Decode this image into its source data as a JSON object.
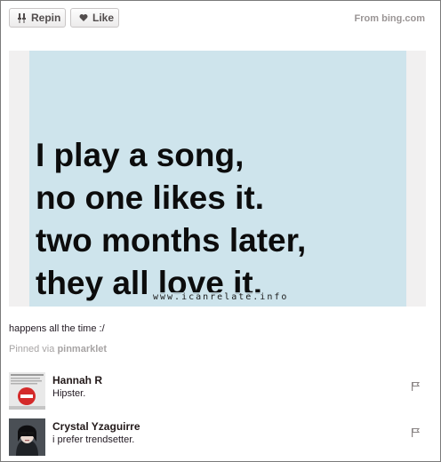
{
  "actions": {
    "repin_label": "Repin",
    "like_label": "Like",
    "repin_icon": "pushpin-icon",
    "like_icon": "heart-icon"
  },
  "source": {
    "text": "From bing.com"
  },
  "pin": {
    "quote_lines": [
      "I play a song,",
      "no one likes it.",
      "two months later,",
      "they all love it."
    ],
    "watermark": "www.icanrelate.info",
    "description": "happens all the time :/",
    "pinned_prefix": "Pinned via",
    "pinned_via": "pinmarklet",
    "image_bg_color": "#cee4ec"
  },
  "comments": [
    {
      "author": "Hannah R",
      "text": "Hipster.",
      "avatar_icon": "no-entry-avatar-icon"
    },
    {
      "author": "Crystal Yzaguirre",
      "text": "i prefer trendsetter.",
      "avatar_icon": "portrait-avatar"
    }
  ],
  "colors": {
    "button_text": "#524d4d",
    "muted_text": "#9a9595"
  }
}
